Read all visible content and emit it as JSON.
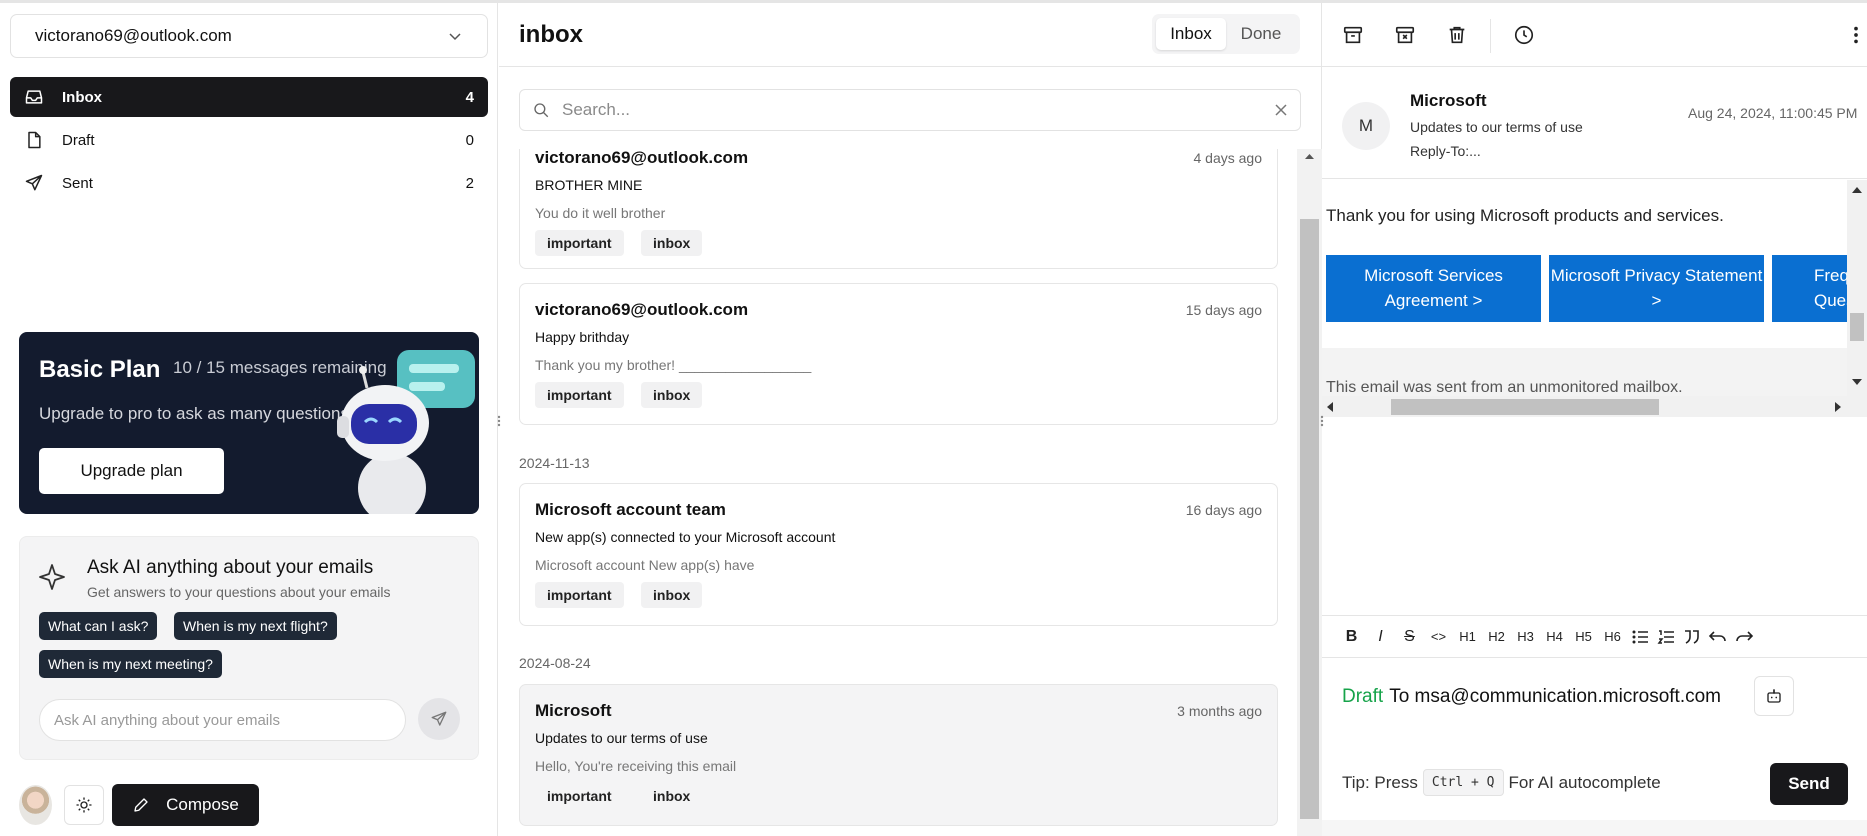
{
  "account": {
    "email": "victorano69@outlook.com"
  },
  "nav": [
    {
      "label": "Inbox",
      "count": "4",
      "icon": "inbox-icon"
    },
    {
      "label": "Draft",
      "count": "0",
      "icon": "file-icon"
    },
    {
      "label": "Sent",
      "count": "2",
      "icon": "send-icon"
    }
  ],
  "plan": {
    "title": "Basic Plan",
    "count": "10 / 15 messages remaining",
    "desc": "Upgrade to pro to ask as many questions",
    "button": "Upgrade plan"
  },
  "ask": {
    "title": "Ask AI anything about your emails",
    "subtitle": "Get answers to your questions about your emails",
    "chips": [
      "What can I ask?",
      "When is my next flight?",
      "When is my next meeting?"
    ],
    "placeholder": "Ask AI anything about your emails"
  },
  "compose_label": "Compose",
  "list": {
    "title": "inbox",
    "tabs": [
      "Inbox",
      "Done"
    ],
    "search_placeholder": "Search...",
    "date_groups": [
      "2024-11-13",
      "2024-08-24"
    ],
    "emails": [
      {
        "from": "victorano69@outlook.com",
        "time": "4 days ago",
        "subject": "BROTHER MINE",
        "preview": "You do it well brother",
        "tags": [
          "important",
          "inbox"
        ]
      },
      {
        "from": "victorano69@outlook.com",
        "time": "15 days ago",
        "subject": "Happy brithday",
        "preview": "Thank you my brother! _________________",
        "tags": [
          "important",
          "inbox"
        ]
      },
      {
        "from": "Microsoft account team",
        "time": "16 days ago",
        "subject": "New app(s) connected to your Microsoft account",
        "preview": "Microsoft account New app(s) have",
        "tags": [
          "important",
          "inbox"
        ]
      },
      {
        "from": "Microsoft",
        "time": "3 months ago",
        "subject": "Updates to our terms of use",
        "preview": "Hello, You're receiving this email",
        "tags": [
          "important",
          "inbox"
        ]
      }
    ]
  },
  "reader": {
    "avatar_letter": "M",
    "from": "Microsoft",
    "subject": "Updates to our terms of use",
    "reply_to": "Reply-To:...",
    "date": "Aug 24, 2024, 11:00:45 PM",
    "body_text": "Thank you for using Microsoft products and services.",
    "buttons": [
      "Microsoft Services Agreement >",
      "Microsoft Privacy Statement >",
      "Frequently Asked Questions"
    ],
    "footer": "This email was sent from an unmonitored mailbox.",
    "format_tools": [
      "B",
      "I",
      "S",
      "<>",
      "H1",
      "H2",
      "H3",
      "H4",
      "H5",
      "H6"
    ],
    "draft_label": "Draft",
    "draft_to": "To msa@communication.microsoft.com",
    "tip_prefix": "Tip: Press",
    "tip_key": "Ctrl + Q",
    "tip_suffix": "For AI autocomplete",
    "send_label": "Send"
  }
}
